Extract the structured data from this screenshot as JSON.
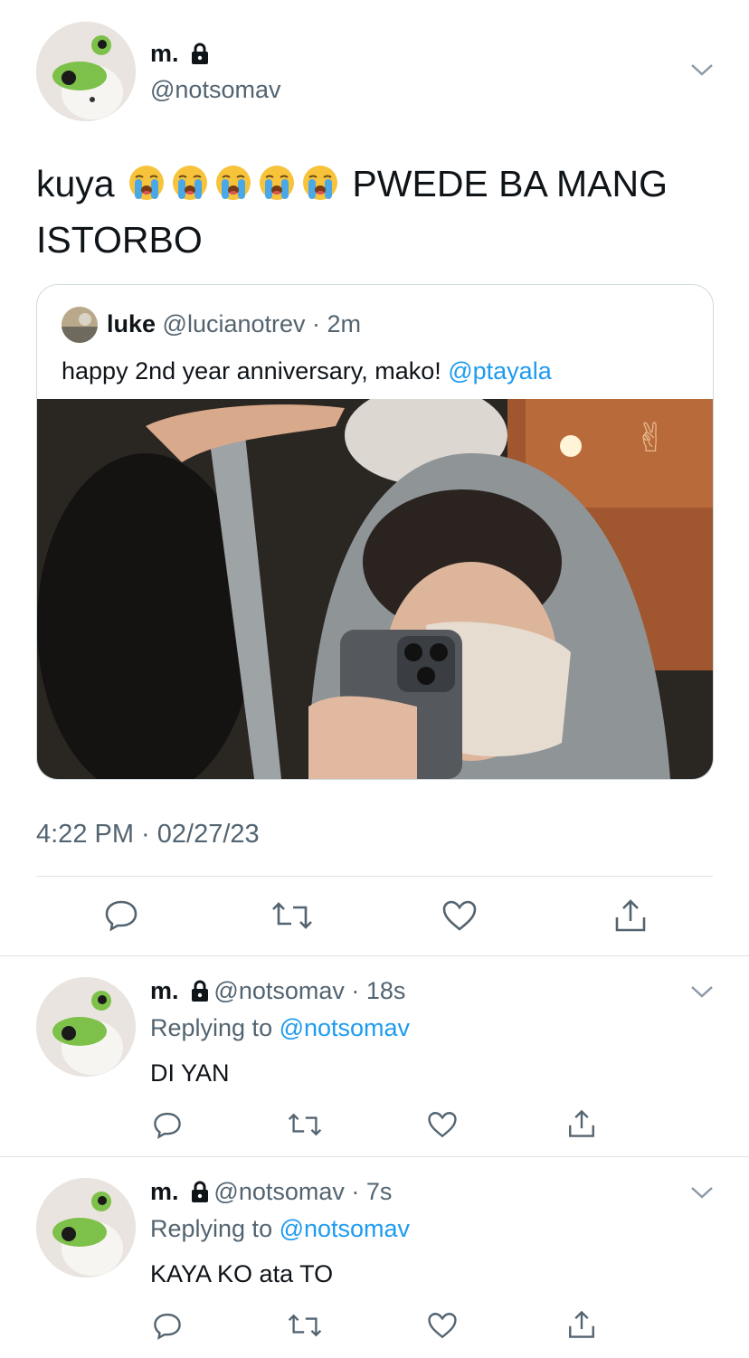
{
  "main_tweet": {
    "display_name": "m.",
    "handle": "@notsomav",
    "text_line1": "kuya",
    "text_after_emoji": "PWEDE BA MANG",
    "text_line2": "ISTORBO",
    "emoji_count": 5,
    "emoji_icon": "loudly-crying-face",
    "timestamp": "4:22 PM · 02/27/23"
  },
  "quoted_tweet": {
    "display_name": "luke",
    "handle_time": "@lucianotrev · 2m",
    "text": "happy 2nd year anniversary, mako! ",
    "mention": "@ptayala"
  },
  "replies": [
    {
      "display_name": "m.",
      "handle_time": "@notsomav · 18s",
      "replying_prefix": "Replying to ",
      "replying_handle": "@notsomav",
      "text": "DI YAN"
    },
    {
      "display_name": "m.",
      "handle_time": "@notsomav · 7s",
      "replying_prefix": "Replying to ",
      "replying_handle": "@notsomav",
      "text": "KAYA KO ata TO"
    }
  ],
  "colors": {
    "text": "#0f1419",
    "secondary": "#536471",
    "link": "#1d9bf0",
    "divider": "#dfe3e6"
  }
}
